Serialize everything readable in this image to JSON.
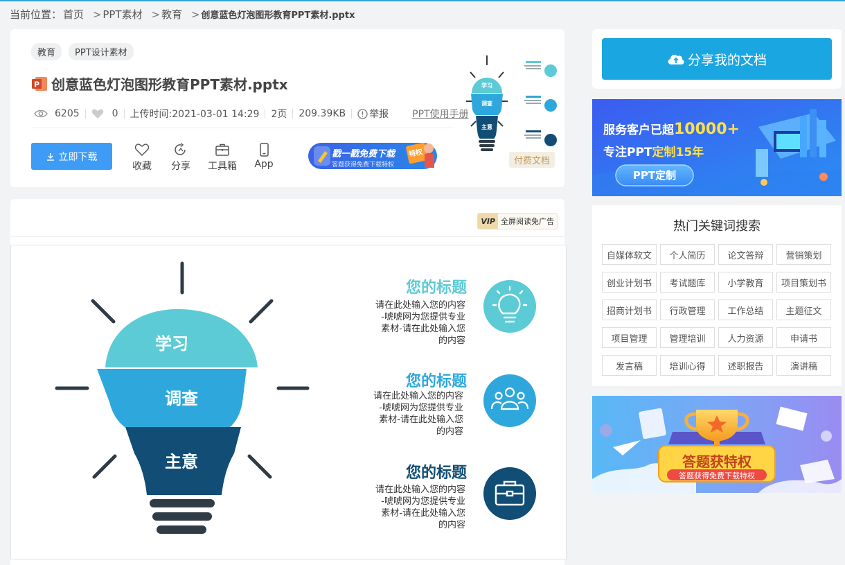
{
  "breadcrumb": {
    "label": "当前位置：",
    "items": [
      "首页",
      "PPT素材",
      "教育"
    ],
    "current": "创意蓝色灯泡图形教育PPT素材.pptx"
  },
  "doc": {
    "tags": [
      "教育",
      "PPT设计素材"
    ],
    "title": "创意蓝色灯泡图形教育PPT素材.pptx",
    "views": "6205",
    "likes": "0",
    "upload_time": "上传时间:2021-03-01 14:29",
    "pages": "2页",
    "size": "209.39KB",
    "report": "举报",
    "manual_link": "PPT使用手册",
    "download_label": "立即下载",
    "actions": [
      "收藏",
      "分享",
      "工具箱",
      "App"
    ],
    "promo_title": "戳一戳免费下载",
    "promo_sub": "答题获得免费下载特权",
    "promo_badge": "特权",
    "paid_badge": "付费文档"
  },
  "preview": {
    "adfree_vip": "VIP",
    "adfree_label": "全屏阅读免广告",
    "bulb_layers": [
      "学习",
      "调查",
      "主意"
    ],
    "items": [
      {
        "title": "您的标题",
        "lines": [
          "请在此处输入您的内容",
          "-唬唬网为您提供专业",
          "素材-请在此处输入您",
          "的内容"
        ],
        "color": "#5ccbd6",
        "icon": "lightbulb-icon"
      },
      {
        "title": "您的标题",
        "lines": [
          "请在此处输入您的内容",
          "-唬唬网为您提供专业",
          "素材-请在此处输入您",
          "的内容"
        ],
        "color": "#2ea8dc",
        "icon": "people-icon"
      },
      {
        "title": "您的标题",
        "lines": [
          "请在此处输入您的内容",
          "-唬唬网为您提供专业",
          "素材-请在此处输入您",
          "的内容"
        ],
        "color": "#114d74",
        "icon": "briefcase-icon"
      }
    ]
  },
  "sidebar": {
    "share_label": "分享我的文档",
    "banner1": {
      "line1": "服务客户已超",
      "line1_num": "10000+",
      "line2": "专注PPT",
      "line2_hl": "定制15年",
      "button": "PPT定制"
    },
    "keywords_title": "热门关键词搜索",
    "keywords": [
      "自媒体软文",
      "个人简历",
      "论文答辩",
      "营销策划",
      "创业计划书",
      "考试题库",
      "小学教育",
      "项目策划书",
      "招商计划书",
      "行政管理",
      "工作总结",
      "主题征文",
      "项目管理",
      "管理培训",
      "人力资源",
      "申请书",
      "发言稿",
      "培训心得",
      "述职报告",
      "演讲稿"
    ],
    "banner2": {
      "title": "答题获特权",
      "sub": "答题获得免费下载特权"
    }
  },
  "colors": {
    "accent": "#1aa6e0",
    "download": "#3e9cf6",
    "bulb_top": "#5ccbd6",
    "bulb_mid": "#2ea8dc",
    "bulb_bottom": "#114d74"
  }
}
